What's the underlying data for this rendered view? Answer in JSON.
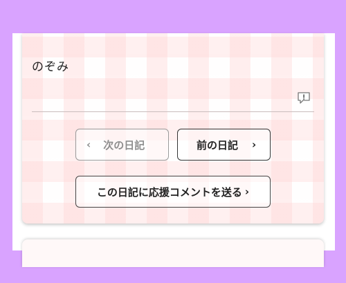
{
  "diary": {
    "author": "のぞみ",
    "report_icon": "report-flag-icon"
  },
  "nav": {
    "next_label": "次の日記",
    "prev_label": "前の日記",
    "comment_label": "この日記に応援コメントを送る",
    "chevron_left": "‹",
    "chevron_right": "›"
  },
  "colors": {
    "background": "#d9a3ff",
    "card": "#fff8f8",
    "plaid": "#ffbebe"
  }
}
